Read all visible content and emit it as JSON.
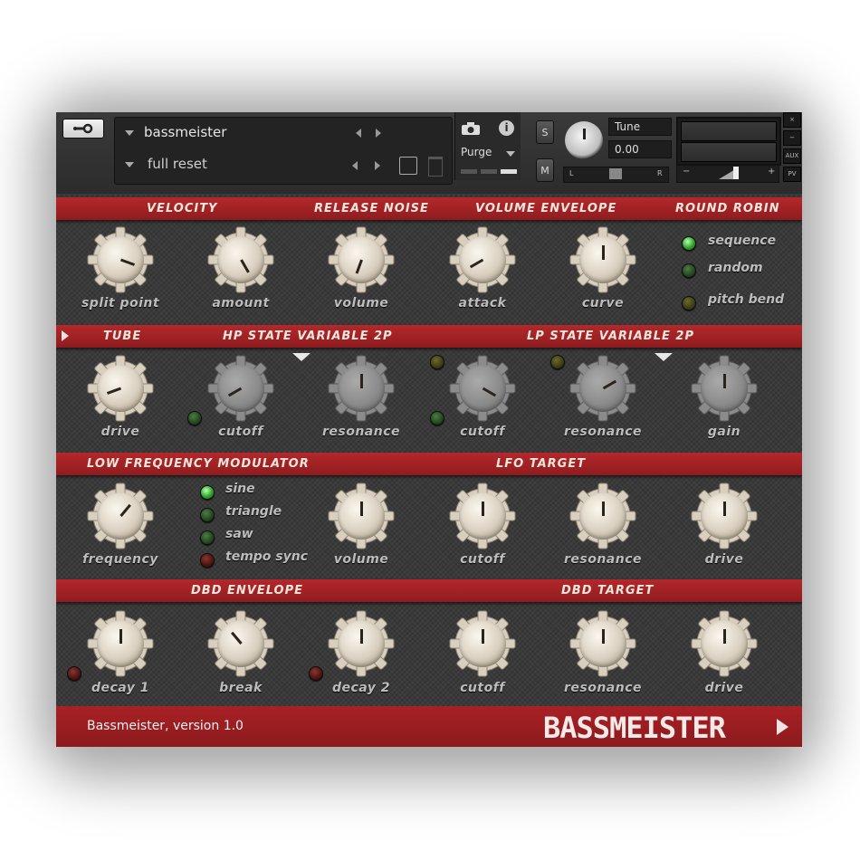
{
  "header": {
    "instrument_name": "bassmeister",
    "preset_name": "full reset",
    "purge_label": "Purge",
    "tune_label": "Tune",
    "tune_value": "0.00",
    "pan_left": "L",
    "pan_right": "R",
    "vol_minus": "−",
    "vol_plus": "+",
    "solo_label": "S",
    "mute_label": "M",
    "close_label": "×",
    "minimize_label": "−",
    "aux_label": "AUX",
    "pv_label": "PV",
    "info_label": "i"
  },
  "sections": {
    "velocity": "VELOCITY",
    "release_noise": "RELEASE NOISE",
    "volume_envelope": "VOLUME ENVELOPE",
    "round_robin": "ROUND ROBIN",
    "tube": "TUBE",
    "hp_filter": "HP STATE VARIABLE 2P",
    "lp_filter": "LP STATE VARIABLE 2P",
    "lfo": "LOW FREQUENCY MODULATOR",
    "lfo_target": "LFO TARGET",
    "dbd_envelope": "DBD ENVELOPE",
    "dbd_target": "DBD TARGET"
  },
  "knobs": {
    "split_point": "split point",
    "amount": "amount",
    "release_volume": "volume",
    "attack": "attack",
    "curve": "curve",
    "drive": "drive",
    "hp_cutoff": "cutoff",
    "hp_resonance": "resonance",
    "lp_cutoff": "cutoff",
    "lp_resonance": "resonance",
    "gain": "gain",
    "frequency": "frequency",
    "lfo_volume": "volume",
    "lfo_cutoff": "cutoff",
    "lfo_resonance": "resonance",
    "lfo_drive": "drive",
    "decay1": "decay 1",
    "break": "break",
    "decay2": "decay 2",
    "dbd_cutoff": "cutoff",
    "dbd_resonance": "resonance",
    "dbd_drive": "drive"
  },
  "round_robin_options": [
    "sequence",
    "random",
    "pitch bend"
  ],
  "lfo_options": [
    "sine",
    "triangle",
    "saw",
    "tempo sync"
  ],
  "footer": {
    "version": "Bassmeister, version 1.0",
    "brand": "BASSMEISTER"
  },
  "colors": {
    "band_red": "#9f2326",
    "panel_gray": "#3a3a3a",
    "led_green": "#2ea32a",
    "led_red": "#b22015"
  }
}
